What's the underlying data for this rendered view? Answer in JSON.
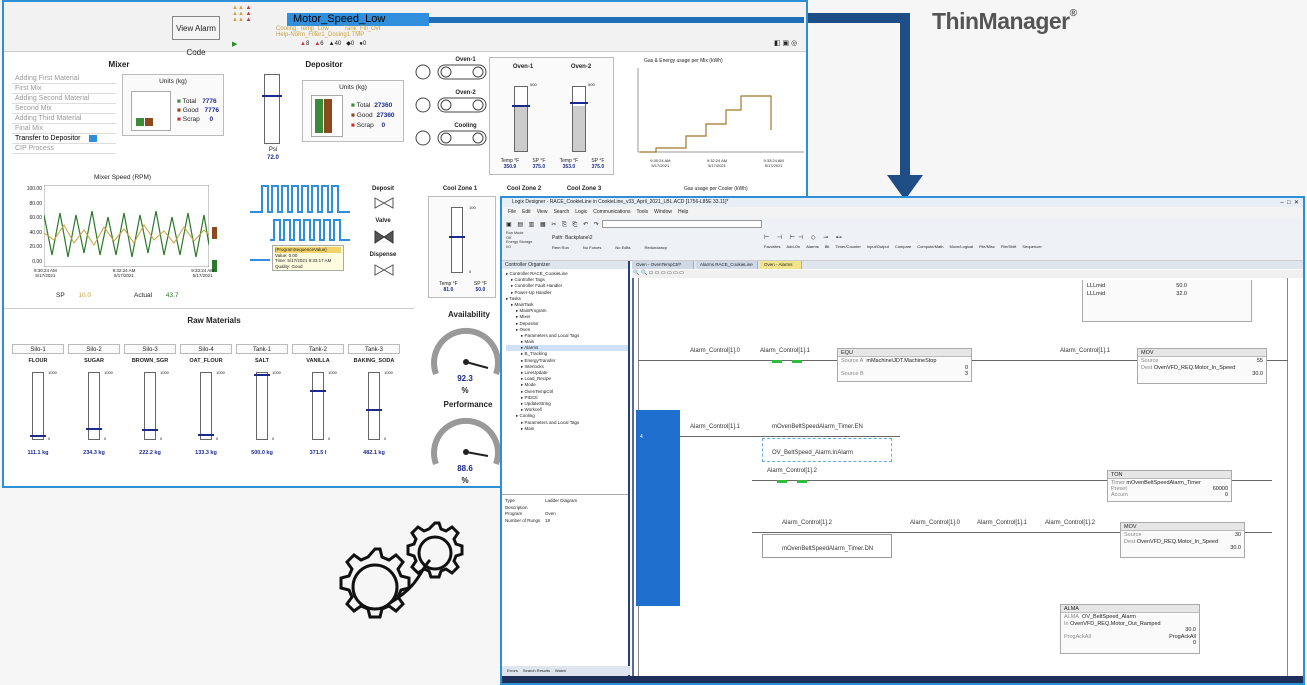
{
  "brand": {
    "name": "ThinManager",
    "mark": "®"
  },
  "hmi": {
    "view_alarm_code": "View Alarm Code",
    "alarm_title": "Motor_Speed_Low",
    "alarm_rows": [
      "Motor_Speed_Low",
      "Cooling_Temp_Low",
      "Tank_Fill_Ovt",
      "Help-Norm_Filler1_Dosing1 TMP"
    ],
    "alarm_counts": [
      "8",
      "6",
      "40",
      "0",
      "0"
    ],
    "mixer": {
      "title": "Mixer",
      "steps": [
        "Adding First Material",
        "First Mix",
        "Adding Second Material",
        "Second Mix",
        "Adding Third Material",
        "Final Mix",
        "Transfer to Depositor",
        "CIP Process"
      ],
      "units_title": "Units (kg)",
      "total_label": "Total",
      "total": "7776",
      "good_label": "Good",
      "good": "7776",
      "scrap_label": "Scrap",
      "scrap": "0",
      "chart_title": "Mixer Speed (RPM)",
      "y_ticks": [
        "100.00",
        "80.00",
        "60.00",
        "40.00",
        "20.00",
        "0.00"
      ],
      "x_ticks": [
        "9:30:24 AM\n5/17/2021",
        "9:32:24 AM\n5/17/2021",
        "9:33:24 AM\n5/17/2021"
      ],
      "sp_label": "SP",
      "sp": "10.0",
      "actual_label": "Actual",
      "actual": "43.7"
    },
    "depositor": {
      "title": "Depositor",
      "units_title": "Units (kg)",
      "total_label": "Total",
      "total": "27360",
      "good_label": "Good",
      "good": "27360",
      "scrap_label": "Scrap",
      "scrap": "0",
      "psi_label": "Psi",
      "psi": "72.0",
      "deposit": "Deposit",
      "valve": "Valve",
      "dispense": "Dispense",
      "tooltip_title": "{ProgramSequenceValue}",
      "tooltip_value": "Value: 0.00",
      "tooltip_time": "Time: 5/17/2021 9:33:17 AM",
      "tooltip_quality": "Quality: Good"
    },
    "ovens": {
      "oven1": "Oven-1",
      "oven2": "Oven-2",
      "cooling": "Cooling",
      "scale_top": "500",
      "scale_bottom": "0",
      "temp_label": "Temp °F",
      "sp_label": "SP °F",
      "oven1_temp": "350.9",
      "oven1_sp": "375.0",
      "oven2_temp": "353.0",
      "oven2_sp": "375.0"
    },
    "cool_zones": {
      "z1": "Cool Zone 1",
      "z2": "Cool Zone 2",
      "z3": "Cool Zone 3",
      "scale_top": "100",
      "scale_bottom": "0",
      "temp_label": "Temp °F",
      "sp_label": "SP °F",
      "z1_temp": "81.0",
      "z1_sp": "50.0"
    },
    "energy_title": "Gas & Energy usage per Mix (kWh)",
    "cooler_title": "Gas usage per Cooler (kWh)",
    "energy_x": [
      "9:30:24 AM\n5/17/2021",
      "9:32:24 AM\n5/17/2021",
      "9:33:24 AM\n5/17/2021"
    ],
    "raw": {
      "title": "Raw Materials",
      "silos": [
        {
          "name": "Silo-1",
          "item": "FLOUR",
          "value": "111.1 kg",
          "level": 0.06
        },
        {
          "name": "Silo-2",
          "item": "SUGAR",
          "value": "234.3 kg",
          "level": 0.16
        },
        {
          "name": "Silo-3",
          "item": "BROWN_SGR",
          "value": "222.2 kg",
          "level": 0.15
        },
        {
          "name": "Silo-4",
          "item": "OAT_FLOUR",
          "value": "133.3 kg",
          "level": 0.07
        },
        {
          "name": "Tank-1",
          "item": "SALT",
          "value": "500.0 kg",
          "level": 0.98
        },
        {
          "name": "Tank-2",
          "item": "VANILLA",
          "value": "371.5 l",
          "level": 0.74
        },
        {
          "name": "Tank-3",
          "item": "BAKING_SODA",
          "value": "482.1 kg",
          "level": 0.46
        }
      ],
      "scale_top": "1000",
      "scale_bottom": "0"
    },
    "availability": {
      "title": "Availability",
      "value": "92.3",
      "unit": "%"
    },
    "performance": {
      "title": "Performance",
      "value": "88.6",
      "unit": "%"
    }
  },
  "logix": {
    "title": "Logix Designer - RACE_CookieLine in CookieLine_v33_April_2021_LBL.ACD [1756-L85E 33.11]*",
    "menu": [
      "File",
      "Edit",
      "View",
      "Search",
      "Logic",
      "Communications",
      "Tools",
      "Window",
      "Help"
    ],
    "path": "Path: Backplane\\2",
    "status_labels": [
      "Run Mode",
      "OK",
      "Energy Storage",
      "I/O"
    ],
    "tool_tabs": [
      "Favorites",
      "Add-On",
      "Alarms",
      "Bit",
      "Timer/Counter",
      "Input/Output",
      "Compare",
      "Compute/Math",
      "Move/Logical",
      "File/Misc",
      "File/Shift",
      "Sequencer"
    ],
    "mode_labels": [
      "Rem Run",
      "No Forces",
      "No Edits",
      "Redundancy"
    ],
    "tabs": [
      "Oven - OvenTempCtrl*",
      "Alarms RACE_CookieLine",
      "Oven - Alarms"
    ],
    "organizer_title": "Controller Organizer",
    "tree": [
      "Controller RACE_CookieLine",
      "Controller Tags",
      "Controller Fault Handler",
      "Power-Up Handler",
      "Tasks",
      "MainTask",
      "MainProgram",
      "Mixer",
      "Depositor",
      "Oven",
      "Parameters and Local Tags",
      "Main",
      "Alarms",
      "B_Tracking",
      "EnergyTransfer",
      "Interlocks",
      "LineUpdate",
      "Load_Recipe",
      "Mode",
      "OvenTempCtrl",
      "PIDCtl",
      "UpdateString",
      "Workcell",
      "Cooling",
      "Parameters and Local Tags",
      "Main"
    ],
    "props": [
      [
        "Type",
        "Ladder Diagram"
      ],
      [
        "Description",
        ""
      ],
      [
        "Program",
        "Oven"
      ],
      [
        "Number of Rungs",
        "19"
      ]
    ],
    "bottom_tabs": [
      "Controller Organizer",
      "Logical Organizer"
    ],
    "status_tabs": [
      "Errors",
      "Search Results",
      "Watch"
    ],
    "rungs": {
      "llmid_l": "LLLmid",
      "llmid_v": "50.0",
      "llmd_l": "LLLmid",
      "llmd_v": "32.0",
      "a10": "Alarm_Control[1].0",
      "a11": "Alarm_Control[1].1",
      "equ": "EQU",
      "src_a": "Source A",
      "src_a_tag": "mMachine\\JDT.MachineStop",
      "src_a_v": "0",
      "src_b": "Source B",
      "src_b_v": "3",
      "a11b": "Alarm_Control[1].1",
      "mov": "MOV",
      "mov_src": "Source",
      "mov_src_v": "55",
      "mov_dest": "Dest",
      "mov_dest_tag": "OvenVFD_REQ.Motor_In_Speed",
      "mov_dest_v": "30.0",
      "rung_no": "4",
      "a11c": "Alarm_Control[1].1",
      "tmr_en": "mOvenBeltSpeedAlarm_Timer.EN",
      "ov_alarm": "OV_BeltSpeed_Alarm.InAlarm",
      "a12": "Alarm_Control[1].2",
      "ton": "TON",
      "timer": "Timer",
      "timer_tag": "mOvenBeltSpeedAlarm_Timer",
      "preset": "Preset",
      "preset_v": "60000",
      "accum": "Accum",
      "accum_v": "0",
      "a12b": "Alarm_Control[1].2",
      "a10b": "Alarm_Control[1].0",
      "a11d": "Alarm_Control[1].1",
      "a12c": "Alarm_Control[1].2",
      "tmr_dn": "mOvenBeltSpeedAlarm_Timer.DN",
      "mov2": "MOV",
      "mov2_src": "Source",
      "mov2_src_v": "30",
      "mov2_dest": "Dest",
      "mov2_dest_tag": "OvenVFD_REQ.Motor_In_Speed",
      "mov2_dest_v": "30.0",
      "alma": "ALMA",
      "alma_tag": "OV_BeltSpeed_Alarm",
      "alma_in": "In",
      "alma_in_tag": "OvenVFD_REQ.Motor_Out_Ramped",
      "alma_in_v": "30.0",
      "alma_prog": "ProgAckAll",
      "alma_prog_v": "ProgAckAll",
      "alma_prog_v2": "0"
    }
  }
}
